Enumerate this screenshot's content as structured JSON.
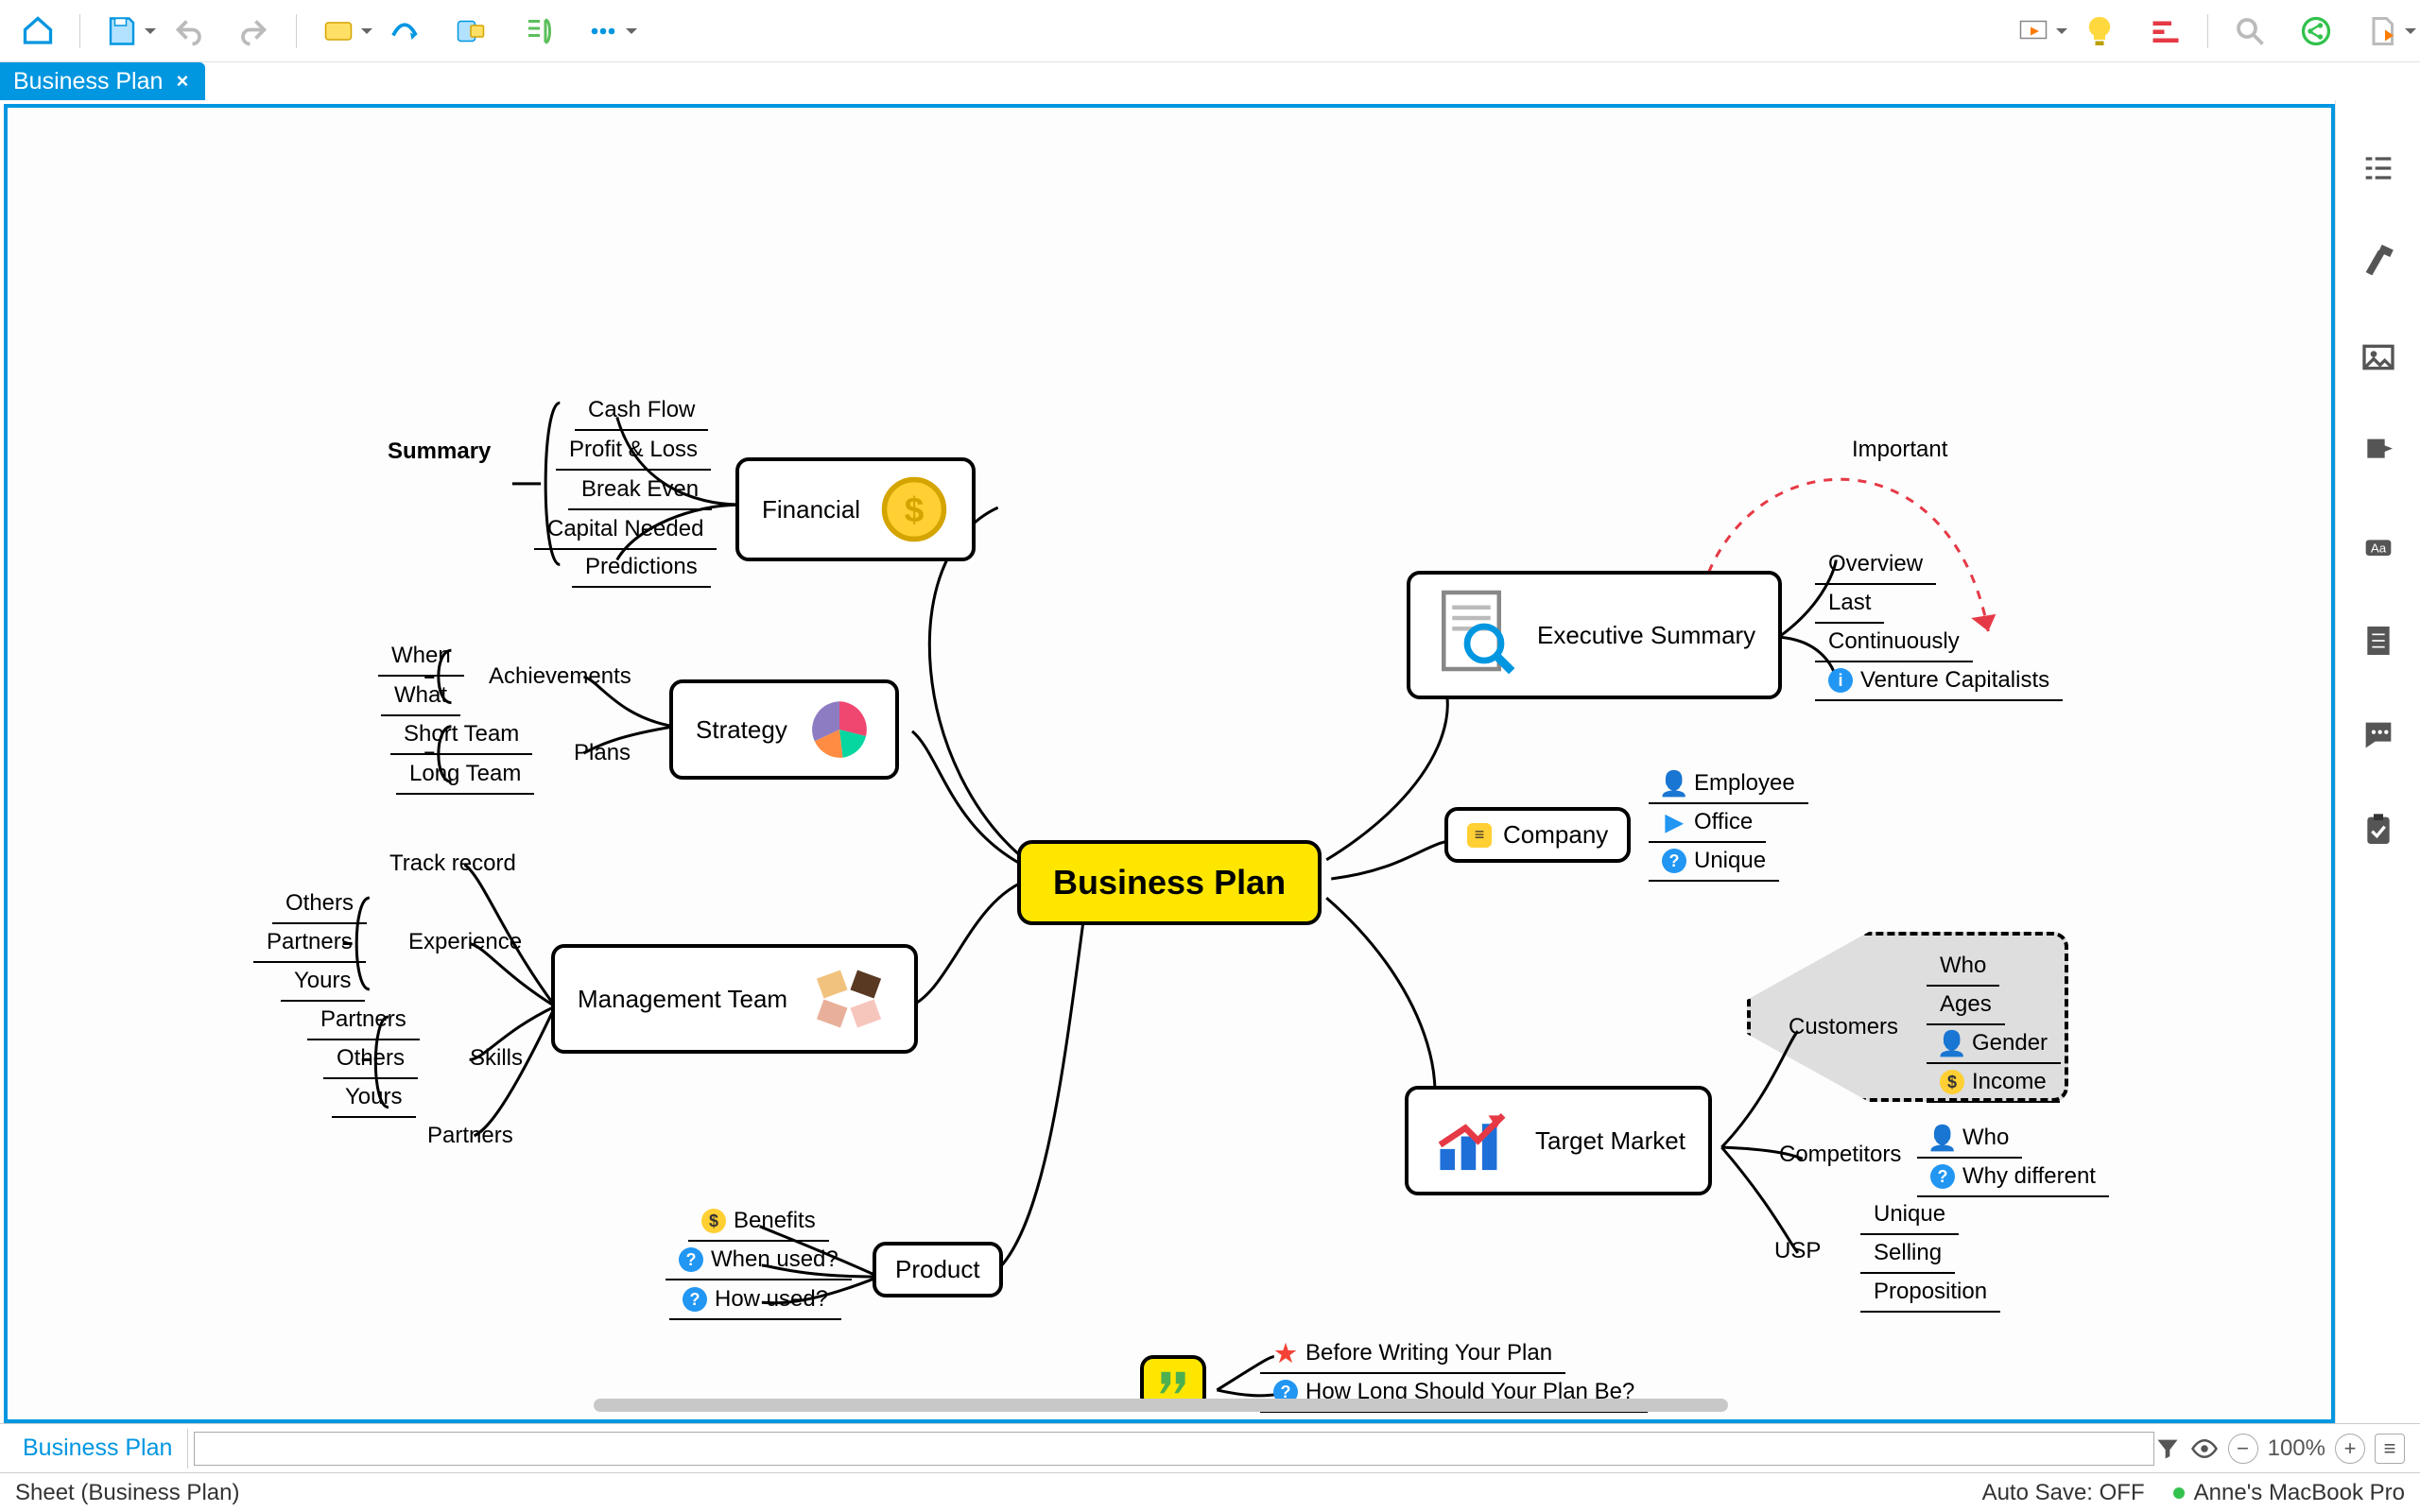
{
  "tab_title": "Business Plan",
  "central": "Business Plan",
  "branches": {
    "financial": {
      "label": "Financial",
      "parent": "Summary",
      "items": [
        "Cash Flow",
        "Profit & Loss",
        "Break Even",
        "Capital Needed",
        "Predictions"
      ]
    },
    "strategy": {
      "label": "Strategy",
      "groups": {
        "achievements": {
          "label": "Achievements",
          "items": [
            "When",
            "What"
          ]
        },
        "plans": {
          "label": "Plans",
          "items": [
            "Short Team",
            "Long Team"
          ]
        }
      }
    },
    "management": {
      "label": "Management Team",
      "groups": {
        "track": {
          "label": "Track record"
        },
        "experience": {
          "label": "Experience",
          "items": [
            "Others",
            "Partners",
            "Yours"
          ]
        },
        "skills": {
          "label": "Skills",
          "items": [
            "Partners",
            "Others",
            "Yours"
          ]
        },
        "partners_leaf": "Partners"
      }
    },
    "product": {
      "label": "Product",
      "items": [
        "Benefits",
        "When used?",
        "How used?"
      ]
    },
    "execsum": {
      "label": "Executive Summary",
      "items": [
        "Overview",
        "Last",
        "Continuously",
        "Venture Capitalists"
      ],
      "arrow_label": "Important"
    },
    "company": {
      "label": "Company",
      "items": [
        "Employee",
        "Office",
        "Unique"
      ]
    },
    "target": {
      "label": "Target Market",
      "groups": {
        "customers": {
          "label": "Customers",
          "items": [
            "Who",
            "Ages",
            "Gender",
            "Income"
          ]
        },
        "competitors": {
          "label": "Competitors",
          "items": [
            "Who",
            "Why different"
          ]
        },
        "usp": {
          "label": "USP",
          "items": [
            "Unique",
            "Selling",
            "Proposition"
          ]
        }
      }
    },
    "floating": {
      "items": [
        "Before Writing Your Plan",
        "How Long Should Your Plan Be?"
      ]
    }
  },
  "sheet_tab": "Business Plan",
  "zoom": "100%",
  "status_left": "Sheet (Business Plan)",
  "status_autosave": "Auto Save: OFF",
  "status_device": "Anne's MacBook Pro"
}
